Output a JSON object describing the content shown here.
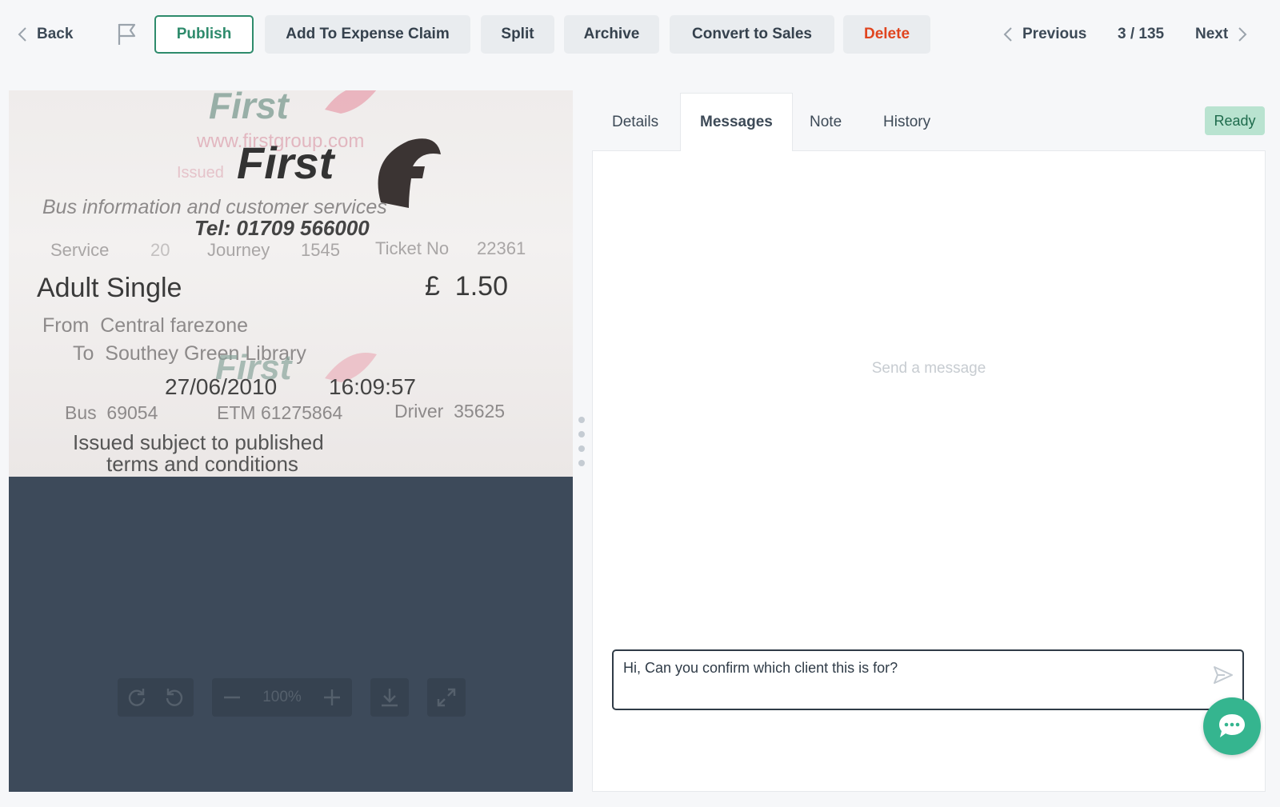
{
  "toolbar": {
    "back_label": "Back",
    "publish_label": "Publish",
    "expense_label": "Add To Expense Claim",
    "split_label": "Split",
    "archive_label": "Archive",
    "convert_label": "Convert to Sales",
    "delete_label": "Delete",
    "previous_label": "Previous",
    "counter": "3 / 135",
    "next_label": "Next"
  },
  "receipt": {
    "brand": "First",
    "website": "www.firstgroup.com",
    "issued_partial": "Issued",
    "services_line": "Bus information and customer services",
    "tel": "Tel: 01709 566000",
    "service_label": "Service",
    "service_no": "20",
    "journey_label": "Journey",
    "journey_no": "1545",
    "ticket_label": "Ticket No",
    "ticket_no": "22361",
    "fare_type": "Adult Single",
    "fare_amount": "£  1.50",
    "from_line": "From  Central farezone",
    "to_line": "To  Southey Green Library",
    "date": "27/06/2010",
    "time": "16:09:57",
    "bus": "Bus  69054",
    "etm": "ETM 61275864",
    "driver": "Driver  35625",
    "terms_1": "Issued subject to published",
    "terms_2": "terms and conditions"
  },
  "viewer_controls": {
    "zoom": "100%",
    "icons": [
      "rotate-cw-icon",
      "rotate-ccw-icon",
      "zoom-out-icon",
      "zoom-in-icon",
      "download-icon",
      "fullscreen-icon"
    ]
  },
  "tabs": [
    {
      "label": "Details",
      "active": false
    },
    {
      "label": "Messages",
      "active": true
    },
    {
      "label": "Note",
      "active": false
    },
    {
      "label": "History",
      "active": false
    }
  ],
  "status_badge": "Ready",
  "messages": {
    "empty_text": "Send a message",
    "draft": "Hi, Can you confirm which client this is for?"
  },
  "colors": {
    "accent": "#2e8b6c",
    "delete": "#e0451f",
    "status_bg": "#b9e3d0",
    "chat_button": "#35b58f",
    "viewer_bg": "#3d4a5a"
  }
}
